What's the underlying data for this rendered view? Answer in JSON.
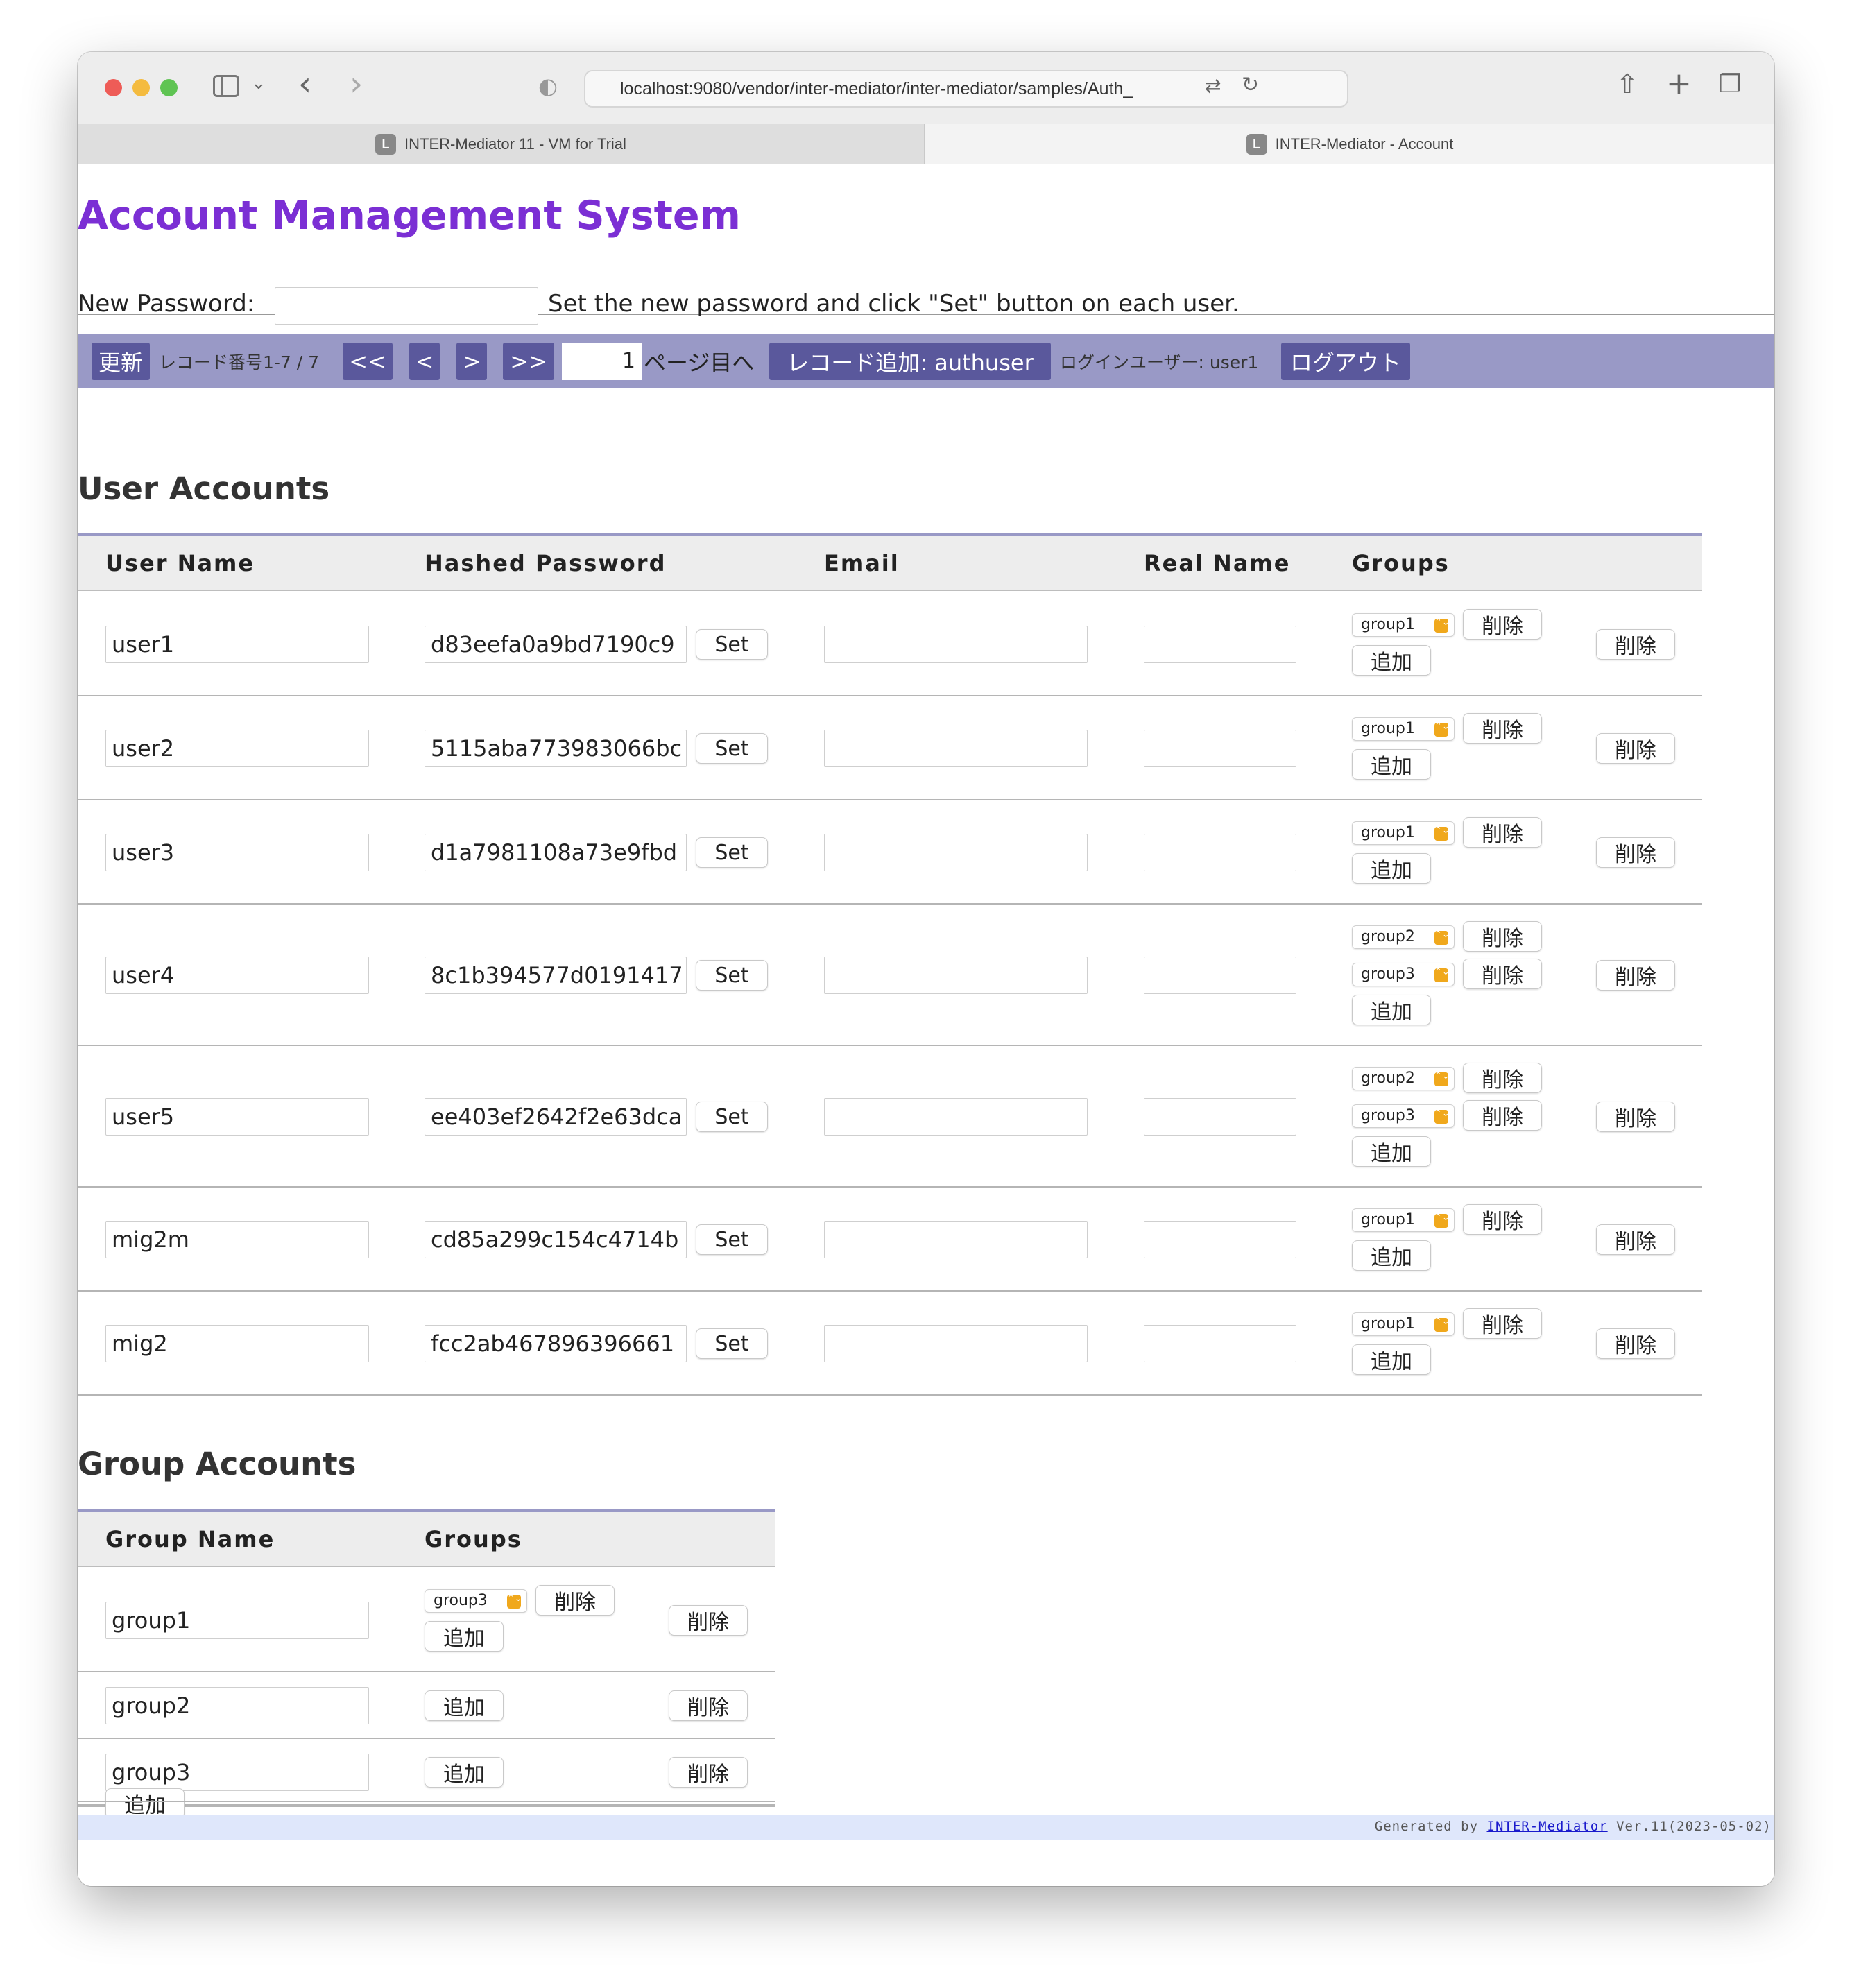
{
  "browser": {
    "url": "localhost:9080/vendor/inter-mediator/inter-mediator/samples/Auth_",
    "tabs": [
      {
        "label": "INTER-Mediator 11 - VM for Trial",
        "favicon": "L"
      },
      {
        "label": "INTER-Mediator - Account",
        "favicon": "L"
      }
    ]
  },
  "page": {
    "title": "Account Management System",
    "password_label": "New Password:",
    "password_value": "",
    "password_hint": "Set the new password and click \"Set\" button on each user."
  },
  "navigation": {
    "refresh": "更新",
    "record_info": "レコード番号1-7 / 7",
    "first": "<<",
    "prev": "<",
    "next": ">",
    "last": ">>",
    "page_value": "1",
    "page_suffix": "ページ目へ",
    "add_record": "レコード追加: authuser",
    "login_user": "ログインユーザー: user1",
    "logout": "ログアウト"
  },
  "users_section": {
    "title": "User Accounts",
    "headers": {
      "username": "User Name",
      "password": "Hashed Password",
      "email": "Email",
      "realname": "Real Name",
      "groups": "Groups"
    },
    "set_label": "Set",
    "delete_label": "削除",
    "add_label": "追加",
    "rows": [
      {
        "username": "user1",
        "hash": "d83eefa0a9bd7190c9",
        "email": "",
        "realname": "",
        "groups": [
          "group1"
        ]
      },
      {
        "username": "user2",
        "hash": "5115aba773983066bc",
        "email": "",
        "realname": "",
        "groups": [
          "group1"
        ]
      },
      {
        "username": "user3",
        "hash": "d1a7981108a73e9fbd",
        "email": "",
        "realname": "",
        "groups": [
          "group1"
        ]
      },
      {
        "username": "user4",
        "hash": "8c1b394577d0191417",
        "email": "",
        "realname": "",
        "groups": [
          "group2",
          "group3"
        ]
      },
      {
        "username": "user5",
        "hash": "ee403ef2642f2e63dca",
        "email": "",
        "realname": "",
        "groups": [
          "group2",
          "group3"
        ]
      },
      {
        "username": "mig2m",
        "hash": "cd85a299c154c4714b",
        "email": "",
        "realname": "",
        "groups": [
          "group1"
        ]
      },
      {
        "username": "mig2",
        "hash": "fcc2ab467896396661",
        "email": "",
        "realname": "",
        "groups": [
          "group1"
        ]
      }
    ]
  },
  "groups_section": {
    "title": "Group Accounts",
    "headers": {
      "groupname": "Group Name",
      "groups": "Groups"
    },
    "delete_label": "削除",
    "add_label": "追加",
    "rows": [
      {
        "groupname": "group1",
        "groups": [
          "group3"
        ]
      },
      {
        "groupname": "group2",
        "groups": []
      },
      {
        "groupname": "group3",
        "groups": []
      }
    ]
  },
  "footer": {
    "prefix": "Generated by ",
    "link": "INTER-Mediator",
    "version": " Ver.11(2023-05-02)"
  },
  "colors": {
    "title": "#7b2fd4",
    "nav_bar": "#9999c6",
    "nav_button": "#5a589c",
    "select_caret": "#f0a81c",
    "footer_bar": "#dfe7fb"
  }
}
